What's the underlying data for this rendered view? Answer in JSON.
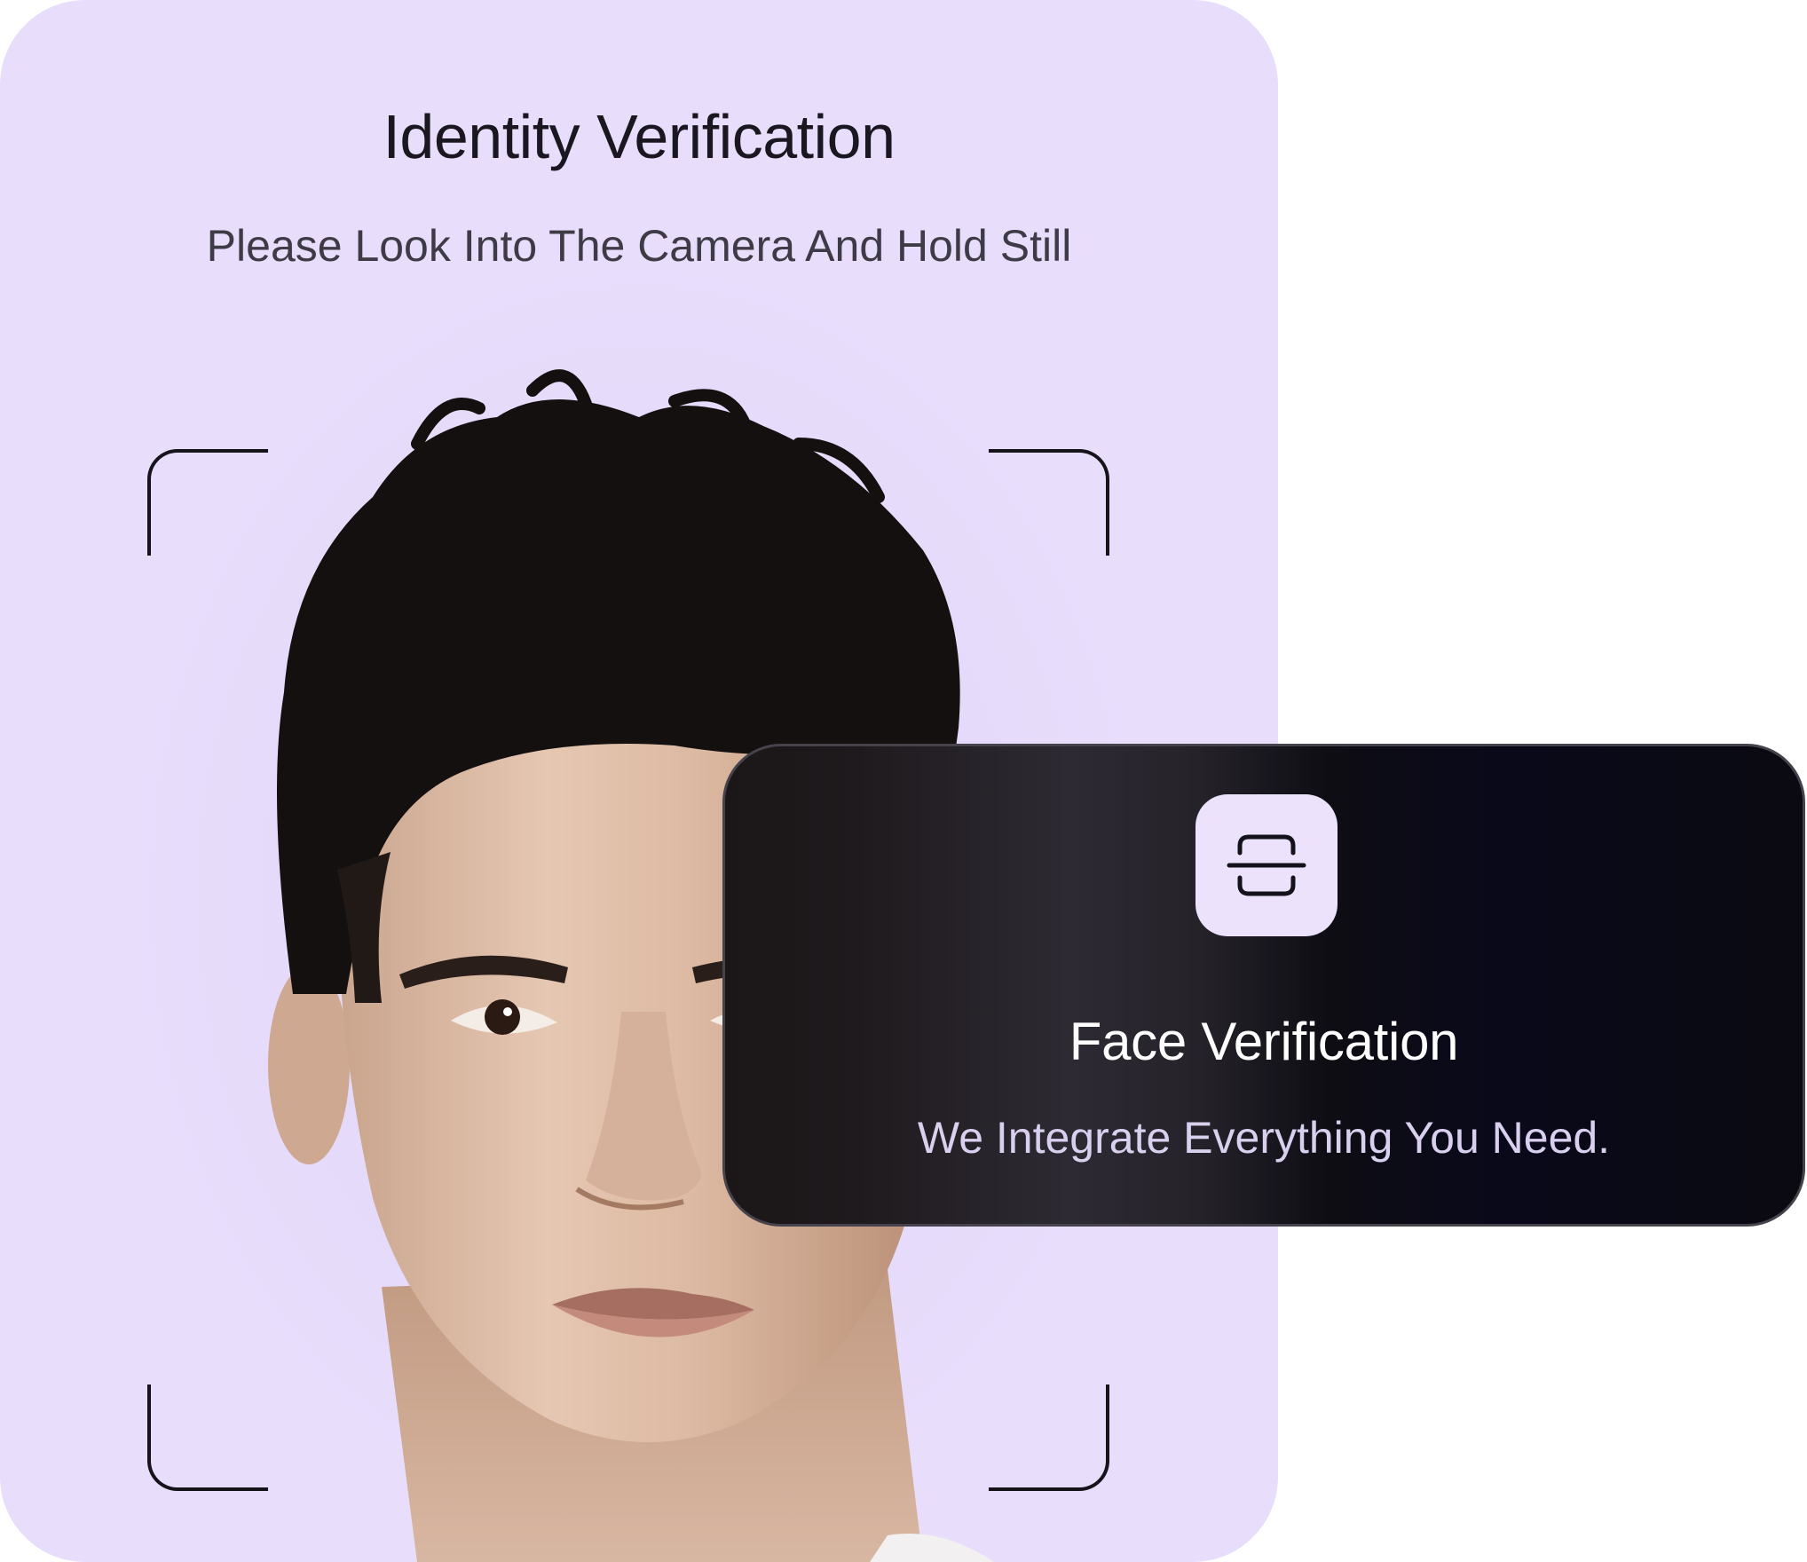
{
  "identity_card": {
    "title": "Identity Verification",
    "subtitle": "Please Look Into The Camera And Hold Still",
    "background_color": "#e8defc"
  },
  "face_card": {
    "icon": "scan-face-icon",
    "title": "Face Verification",
    "subtitle": "We Integrate Everything You Need.",
    "icon_tile_color": "#ece2fb"
  },
  "colors": {
    "accent": "#e8defc",
    "dark_card": "#0b0a12",
    "frame": "#16131b"
  }
}
